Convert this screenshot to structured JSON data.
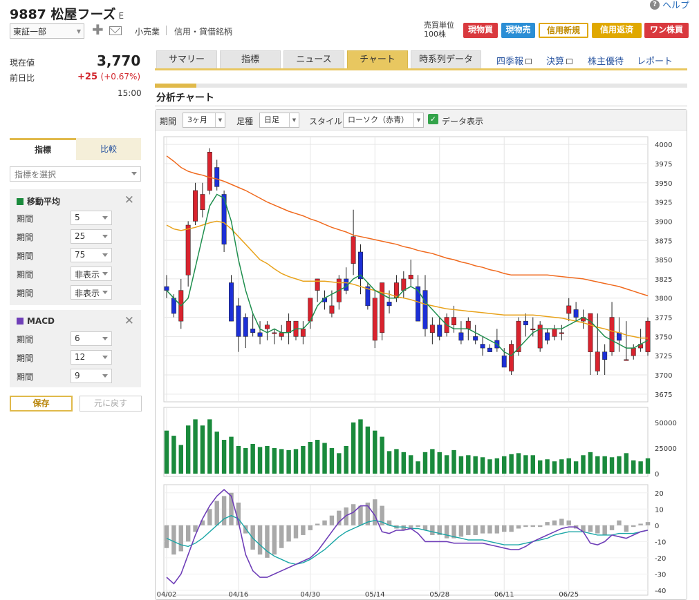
{
  "header": {
    "code_name": "9887 松屋フーズ",
    "market_mark": "E",
    "help": "ヘルプ",
    "exchange": "東証一部",
    "category": "小売業",
    "credit": "信用・貸借銘柄",
    "unit_line1": "売買単位",
    "unit_line2": "100株"
  },
  "trade_buttons": [
    "現物買",
    "現物売",
    "信用新規",
    "信用返済",
    "ワン株買"
  ],
  "quote": {
    "price_label": "現在値",
    "price": "3,770",
    "change_label": "前日比",
    "change": "+25",
    "change_pct": "(+0.67%)",
    "time": "15:00"
  },
  "tabs": [
    "サマリー",
    "指標",
    "ニュース",
    "チャート",
    "時系列データ"
  ],
  "active_tab": 3,
  "links": [
    "四季報",
    "決算",
    "株主優待",
    "レポート"
  ],
  "section_title": "分析チャート",
  "controls": {
    "period_label": "期間",
    "period_value": "3ヶ月",
    "foot_label": "足種",
    "foot_value": "日足",
    "style_label": "スタイル",
    "style_value": "ローソク（赤青）",
    "data_display": "データ表示"
  },
  "side_tabs": [
    "指標",
    "比較"
  ],
  "indicator_placeholder": "指標を選択",
  "ma_panel": {
    "title": "移動平均",
    "color": "#1a8a3c",
    "rows": [
      {
        "label": "期間",
        "value": "5"
      },
      {
        "label": "期間",
        "value": "25"
      },
      {
        "label": "期間",
        "value": "75"
      },
      {
        "label": "期間",
        "value": "非表示"
      },
      {
        "label": "期間",
        "value": "非表示"
      }
    ]
  },
  "macd_panel": {
    "title": "MACD",
    "color": "#6f3fb8",
    "rows": [
      {
        "label": "期間",
        "value": "6"
      },
      {
        "label": "期間",
        "value": "12"
      },
      {
        "label": "期間",
        "value": "9"
      }
    ]
  },
  "save_label": "保存",
  "reset_label": "元に戻す",
  "chart_data": [
    {
      "type": "candlestick",
      "yticks": [
        4000,
        3975,
        3950,
        3925,
        3900,
        3875,
        3850,
        3825,
        3800,
        3775,
        3750,
        3725,
        3700,
        3675
      ],
      "xticks": [
        "04/02",
        "04/16",
        "04/30",
        "05/14",
        "05/28",
        "06/11",
        "06/25"
      ],
      "colors": {
        "up": "#d9232e",
        "down": "#1c2fd6",
        "ma5": "#1f8f4e",
        "ma25": "#e8a21a",
        "ma75": "#f06a1e"
      },
      "ohlc": [
        [
          3815,
          3830,
          3800,
          3810
        ],
        [
          3800,
          3805,
          3775,
          3780
        ],
        [
          3770,
          3825,
          3760,
          3810
        ],
        [
          3830,
          3900,
          3815,
          3895
        ],
        [
          3900,
          3950,
          3895,
          3940
        ],
        [
          3915,
          3950,
          3905,
          3935
        ],
        [
          3940,
          3995,
          3935,
          3990
        ],
        [
          3970,
          3980,
          3940,
          3945
        ],
        [
          3935,
          3940,
          3860,
          3870
        ],
        [
          3820,
          3830,
          3770,
          3770
        ],
        [
          3790,
          3800,
          3730,
          3750
        ],
        [
          3775,
          3780,
          3735,
          3750
        ],
        [
          3760,
          3780,
          3750,
          3755
        ],
        [
          3755,
          3770,
          3740,
          3750
        ],
        [
          3760,
          3770,
          3745,
          3765
        ],
        [
          3755,
          3760,
          3740,
          3755
        ],
        [
          3750,
          3765,
          3745,
          3755
        ],
        [
          3755,
          3780,
          3740,
          3770
        ],
        [
          3750,
          3765,
          3745,
          3770
        ],
        [
          3750,
          3770,
          3740,
          3760
        ],
        [
          3770,
          3800,
          3760,
          3800
        ],
        [
          3810,
          3825,
          3795,
          3825
        ],
        [
          3800,
          3810,
          3785,
          3795
        ],
        [
          3780,
          3810,
          3775,
          3790
        ],
        [
          3795,
          3830,
          3785,
          3825
        ],
        [
          3825,
          3840,
          3805,
          3810
        ],
        [
          3845,
          3915,
          3830,
          3880
        ],
        [
          3860,
          3870,
          3805,
          3825
        ],
        [
          3815,
          3820,
          3785,
          3790
        ],
        [
          3745,
          3810,
          3735,
          3800
        ],
        [
          3755,
          3820,
          3745,
          3820
        ],
        [
          3795,
          3810,
          3780,
          3790
        ],
        [
          3800,
          3830,
          3795,
          3820
        ],
        [
          3810,
          3835,
          3800,
          3825
        ],
        [
          3825,
          3850,
          3815,
          3830
        ],
        [
          3815,
          3830,
          3770,
          3770
        ],
        [
          3810,
          3830,
          3750,
          3760
        ],
        [
          3755,
          3775,
          3740,
          3765
        ],
        [
          3765,
          3775,
          3745,
          3750
        ],
        [
          3755,
          3780,
          3750,
          3775
        ],
        [
          3765,
          3790,
          3755,
          3775
        ],
        [
          3755,
          3770,
          3740,
          3745
        ],
        [
          3760,
          3775,
          3745,
          3770
        ],
        [
          3750,
          3765,
          3740,
          3745
        ],
        [
          3740,
          3750,
          3725,
          3735
        ],
        [
          3735,
          3740,
          3730,
          3730
        ],
        [
          3745,
          3760,
          3730,
          3735
        ],
        [
          3725,
          3735,
          3715,
          3710
        ],
        [
          3705,
          3745,
          3700,
          3740
        ],
        [
          3730,
          3775,
          3725,
          3770
        ],
        [
          3770,
          3780,
          3750,
          3765
        ],
        [
          3760,
          3775,
          3750,
          3760
        ],
        [
          3735,
          3770,
          3730,
          3765
        ],
        [
          3755,
          3760,
          3740,
          3745
        ],
        [
          3750,
          3765,
          3745,
          3760
        ],
        [
          3755,
          3765,
          3745,
          3755
        ],
        [
          3780,
          3800,
          3770,
          3790
        ],
        [
          3785,
          3795,
          3770,
          3775
        ],
        [
          3770,
          3785,
          3760,
          3775
        ],
        [
          3730,
          3780,
          3700,
          3780
        ],
        [
          3705,
          3780,
          3700,
          3730
        ],
        [
          3730,
          3740,
          3700,
          3720
        ],
        [
          3730,
          3795,
          3725,
          3775
        ],
        [
          3755,
          3775,
          3730,
          3745
        ],
        [
          3720,
          3770,
          3720,
          3720
        ],
        [
          3725,
          3740,
          3720,
          3735
        ],
        [
          3735,
          3760,
          3730,
          3740
        ],
        [
          3730,
          3775,
          3725,
          3770
        ]
      ],
      "ma5": [
        3810,
        3800,
        3790,
        3800,
        3840,
        3880,
        3920,
        3935,
        3930,
        3900,
        3850,
        3810,
        3780,
        3760,
        3755,
        3760,
        3755,
        3755,
        3760,
        3760,
        3770,
        3790,
        3800,
        3805,
        3810,
        3815,
        3825,
        3830,
        3820,
        3810,
        3805,
        3800,
        3800,
        3810,
        3815,
        3810,
        3795,
        3785,
        3775,
        3765,
        3760,
        3760,
        3760,
        3755,
        3750,
        3745,
        3740,
        3730,
        3725,
        3735,
        3745,
        3755,
        3760,
        3760,
        3760,
        3760,
        3765,
        3770,
        3775,
        3770,
        3760,
        3750,
        3745,
        3740,
        3735,
        3735,
        3740,
        3745
      ],
      "ma25": [
        3895,
        3890,
        3888,
        3890,
        3892,
        3895,
        3898,
        3900,
        3898,
        3890,
        3880,
        3870,
        3860,
        3850,
        3845,
        3838,
        3832,
        3828,
        3825,
        3822,
        3822,
        3822,
        3822,
        3821,
        3820,
        3820,
        3818,
        3815,
        3812,
        3810,
        3807,
        3805,
        3802,
        3800,
        3798,
        3795,
        3792,
        3790,
        3788,
        3786,
        3785,
        3784,
        3783,
        3782,
        3781,
        3780,
        3779,
        3778,
        3778,
        3778,
        3778,
        3778,
        3777,
        3776,
        3775,
        3774,
        3772,
        3770,
        3768,
        3765,
        3762,
        3760,
        3757,
        3755,
        3752,
        3750,
        3748,
        3748
      ],
      "ma75": [
        3985,
        3978,
        3970,
        3965,
        3962,
        3960,
        3957,
        3955,
        3952,
        3948,
        3944,
        3940,
        3935,
        3930,
        3925,
        3921,
        3917,
        3913,
        3910,
        3907,
        3903,
        3900,
        3896,
        3892,
        3889,
        3886,
        3882,
        3880,
        3878,
        3876,
        3874,
        3872,
        3870,
        3867,
        3865,
        3862,
        3860,
        3858,
        3855,
        3852,
        3850,
        3847,
        3845,
        3842,
        3840,
        3837,
        3835,
        3832,
        3830,
        3830,
        3830,
        3830,
        3830,
        3830,
        3829,
        3828,
        3827,
        3826,
        3825,
        3823,
        3821,
        3819,
        3817,
        3815,
        3812,
        3809,
        3806,
        3803
      ]
    },
    {
      "type": "bar",
      "yticks": [
        50000,
        25000,
        0
      ],
      "values": [
        42000,
        37000,
        28000,
        47000,
        53000,
        47000,
        53000,
        41000,
        33000,
        36000,
        27000,
        25000,
        29000,
        26000,
        27000,
        25000,
        24000,
        23000,
        24000,
        27000,
        31000,
        33000,
        30000,
        25000,
        20000,
        27000,
        50000,
        53000,
        46000,
        42000,
        36000,
        22000,
        24000,
        21000,
        18000,
        12000,
        21000,
        24000,
        21000,
        18000,
        23000,
        17000,
        18000,
        17000,
        16000,
        14000,
        15000,
        17000,
        19000,
        20000,
        18000,
        18000,
        13000,
        14000,
        12000,
        14000,
        15000,
        12000,
        18000,
        21000,
        17000,
        17000,
        16000,
        17000,
        20000,
        13000,
        12000,
        15000,
        20000
      ]
    },
    {
      "type": "macd",
      "yticks": [
        20,
        10,
        0,
        -10,
        -20,
        -30,
        -40
      ],
      "hist": [
        -14,
        -18,
        -16,
        -10,
        -4,
        3,
        10,
        15,
        18,
        20,
        14,
        -5,
        -15,
        -18,
        -20,
        -18,
        -14,
        -10,
        -8,
        -6,
        -3,
        1,
        3,
        6,
        9,
        11,
        13,
        12,
        14,
        16,
        12,
        3,
        -2,
        -3,
        -2,
        -1,
        -3,
        -6,
        -6,
        -8,
        -8,
        -7,
        -6,
        -6,
        -5,
        -5,
        -5,
        -4,
        -4,
        -2,
        -1,
        -1,
        -1,
        2,
        3,
        4,
        3,
        -2,
        -4,
        -4,
        -5,
        -6,
        -3,
        3,
        -4,
        -1,
        1,
        2,
        4
      ],
      "macd": [
        -32,
        -36,
        -30,
        -18,
        -6,
        4,
        12,
        18,
        22,
        18,
        2,
        -18,
        -28,
        -32,
        -32,
        -30,
        -28,
        -26,
        -24,
        -22,
        -20,
        -16,
        -10,
        -4,
        2,
        6,
        8,
        12,
        12,
        6,
        -4,
        -5,
        -3,
        -3,
        -2,
        -5,
        -10,
        -10,
        -10,
        -10,
        -11,
        -11,
        -11,
        -11,
        -11,
        -12,
        -13,
        -14,
        -15,
        -15,
        -13,
        -10,
        -8,
        -6,
        -4,
        -2,
        -1,
        -1,
        -4,
        -11,
        -12,
        -10,
        -6,
        -7,
        -8,
        -6,
        -4,
        -3,
        -1
      ],
      "signal": [
        -8,
        -10,
        -12,
        -13,
        -11,
        -8,
        -4,
        0,
        4,
        6,
        4,
        -2,
        -8,
        -12,
        -16,
        -19,
        -21,
        -23,
        -24,
        -23,
        -21,
        -18,
        -15,
        -11,
        -7,
        -4,
        -2,
        0,
        2,
        3,
        2,
        0,
        -1,
        -1,
        -2,
        -2,
        -3,
        -4,
        -5,
        -6,
        -7,
        -8,
        -9,
        -9,
        -9,
        -10,
        -11,
        -12,
        -12,
        -12,
        -11,
        -10,
        -9,
        -8,
        -6,
        -5,
        -4,
        -4,
        -4,
        -5,
        -6,
        -6,
        -6,
        -5,
        -5,
        -5,
        -4,
        -3,
        -3
      ]
    }
  ]
}
